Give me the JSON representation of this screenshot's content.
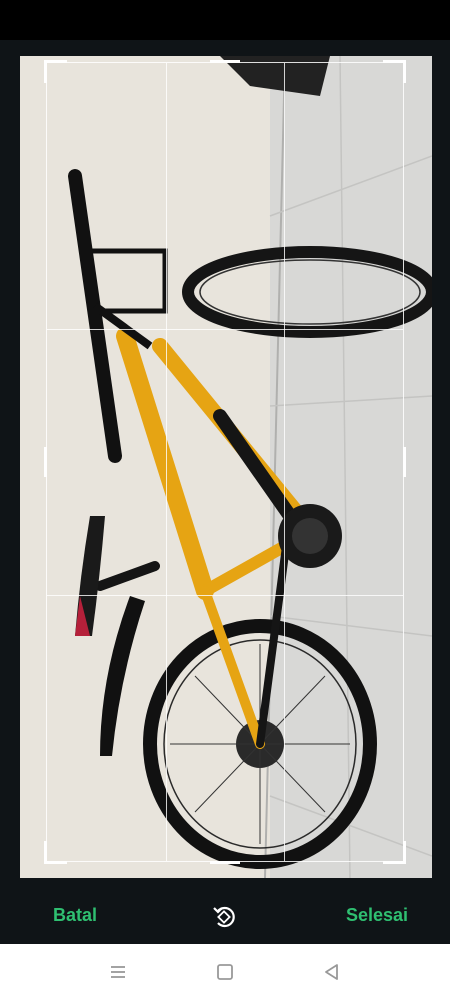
{
  "screen": {
    "title": "crop-editor"
  },
  "crop": {
    "image_content": "bicycle-photo",
    "aspect": "free"
  },
  "actions": {
    "cancel_label": "Batal",
    "done_label": "Selesai",
    "rotate_icon": "rotate-icon",
    "accent_color": "#2fbf71"
  },
  "navigation": {
    "menu_icon": "menu-icon",
    "home_icon": "home-icon",
    "back_icon": "back-icon"
  }
}
